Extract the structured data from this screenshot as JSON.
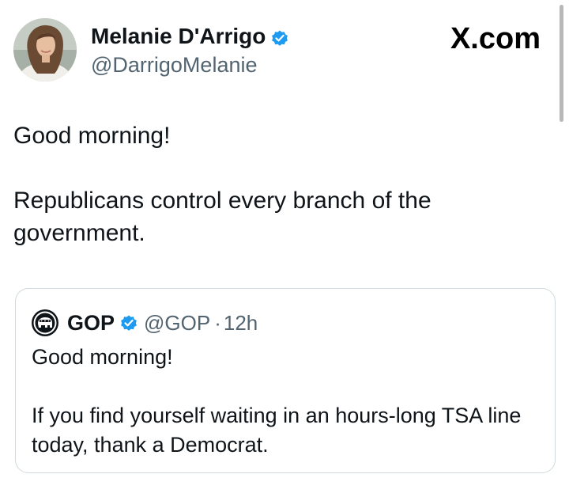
{
  "author": {
    "display_name": "Melanie D'Arrigo",
    "handle": "@DarrigoMelanie",
    "verified_icon": "verified-badge-icon",
    "verified_color": "#1d9bf0"
  },
  "site_label": "X.com",
  "tweet": {
    "text": "Good morning!\n\nRepublicans control every branch of the government."
  },
  "quoted_tweet": {
    "display_name": "GOP",
    "handle": "@GOP",
    "separator": "·",
    "time": "12h",
    "avatar_icon": "gop-elephant-logo-icon",
    "text": "Good morning!\n\nIf you find yourself waiting in an hours-long TSA line today, thank a Democrat."
  },
  "colors": {
    "text": "#0f1419",
    "secondary": "#536471",
    "border": "#cfd9de",
    "accent": "#1d9bf0"
  }
}
